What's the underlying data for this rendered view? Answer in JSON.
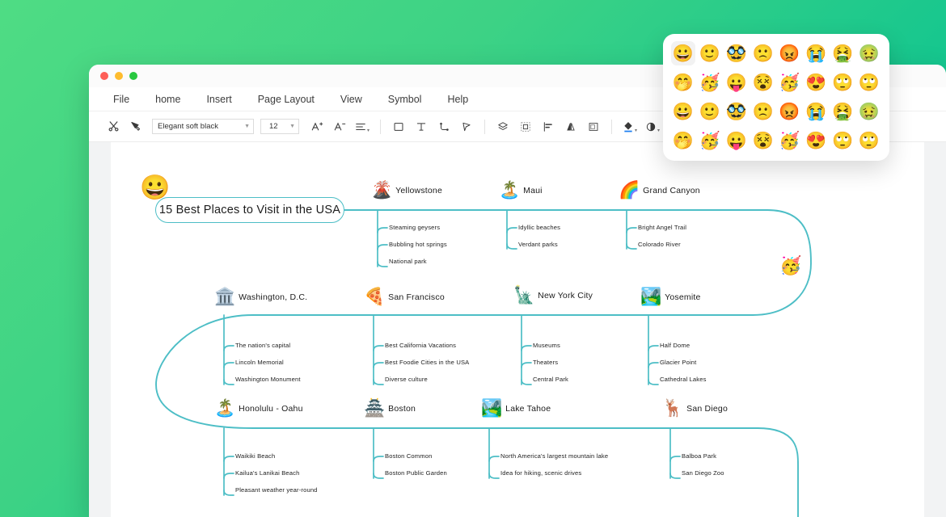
{
  "background": {
    "gradient_from": "#4fdc84",
    "gradient_to": "#00be93"
  },
  "window": {
    "traffic_lights": [
      "close",
      "minimize",
      "maximize"
    ],
    "menu": [
      {
        "label": "File"
      },
      {
        "label": "home"
      },
      {
        "label": "Insert"
      },
      {
        "label": "Page Layout"
      },
      {
        "label": "View"
      },
      {
        "label": "Symbol"
      },
      {
        "label": "Help"
      }
    ],
    "toolbar": {
      "cut_icon": "scissors-icon",
      "format_painter_icon": "format-painter-icon",
      "font_family_value": "Elegant soft black",
      "font_size_value": "12",
      "increase_font_icon": "increase-font-icon",
      "decrease_font_icon": "decrease-font-icon",
      "line_spacing_icon": "line-spacing-icon",
      "shape_icon": "rectangle-shape-icon",
      "text_icon": "text-box-icon",
      "connector_icon": "connector-icon",
      "pointer_icon": "pointer-icon",
      "layers_icon": "layers-icon",
      "group_icon": "group-icon",
      "align_icon": "align-left-icon",
      "flip_icon": "flip-horizontal-icon",
      "distribute_icon": "distribute-icon",
      "fill_color_icon": "fill-color-icon",
      "opacity_icon": "opacity-icon",
      "crop_icon": "crop-icon"
    }
  },
  "emoji_panel": {
    "rows": [
      [
        "😀",
        "🙂",
        "🥸",
        "🙁",
        "😡",
        "😭",
        "🤮",
        "🤢"
      ],
      [
        "🤭",
        "🥳",
        "😛",
        "😵",
        "🥳",
        "😍",
        "🙄",
        "🙄"
      ],
      [
        "😀",
        "🙂",
        "🥸",
        "🙁",
        "😡",
        "😭",
        "🤮",
        "🤢"
      ],
      [
        "🤭",
        "🥳",
        "😛",
        "😵",
        "🥳",
        "😍",
        "🙄",
        "🙄"
      ]
    ],
    "selected": {
      "row": 0,
      "col": 0
    }
  },
  "mindmap": {
    "line_color": "#4dbec6",
    "central_topic": "15 Best Places to Visit in the USA",
    "central_emoji": "😀",
    "curve_emoji": "🥳",
    "branches": [
      {
        "label": "Yellowstone",
        "icon": "🌋",
        "icon_name": "volcano-icon",
        "children": [
          "Steaming geysers",
          "Bubbling hot springs",
          "National park"
        ]
      },
      {
        "label": "Maui",
        "icon": "🏝️",
        "icon_name": "island-icon",
        "children": [
          "Idyllic beaches",
          "Verdant parks"
        ]
      },
      {
        "label": "Grand Canyon",
        "icon": "🌈",
        "icon_name": "rainbow-icon",
        "children": [
          "Bright Angel Trail",
          "Colorado River"
        ]
      },
      {
        "label": "Washington, D.C.",
        "icon": "🏛️",
        "icon_name": "capitol-building-icon",
        "children": [
          "The nation's capital",
          "Lincoln Memorial",
          "Washington Monument"
        ]
      },
      {
        "label": "San Francisco",
        "icon": "🍕",
        "icon_name": "pizza-icon",
        "children": [
          "Best California Vacations",
          "Best Foodie Cities in the USA",
          "Diverse culture"
        ]
      },
      {
        "label": "New York City",
        "icon": "🗽",
        "icon_name": "statue-of-liberty-icon",
        "children": [
          "Museums",
          "Theaters",
          "Central Park"
        ]
      },
      {
        "label": "Yosemite",
        "icon": "🏞️",
        "icon_name": "national-park-icon",
        "children": [
          "Half Dome",
          "Glacier Point",
          "Cathedral Lakes"
        ]
      },
      {
        "label": "Honolulu - Oahu",
        "icon": "🏝️",
        "icon_name": "beach-palm-icon",
        "children": [
          "Waikiki Beach",
          "Kailua's Lanikai Beach",
          "Pleasant weather year-round"
        ]
      },
      {
        "label": "Boston",
        "icon": "🏯",
        "icon_name": "castle-icon",
        "children": [
          "Boston Common",
          "Boston Public Garden"
        ]
      },
      {
        "label": "Lake Tahoe",
        "icon": "🏞️",
        "icon_name": "lake-mountain-icon",
        "children": [
          "North America's largest mountain lake",
          "Idea for hiking, scenic drives"
        ]
      },
      {
        "label": "San Diego",
        "icon": "🦌",
        "icon_name": "deer-icon",
        "children": [
          "Balboa Park",
          "San Diego Zoo"
        ]
      }
    ]
  }
}
